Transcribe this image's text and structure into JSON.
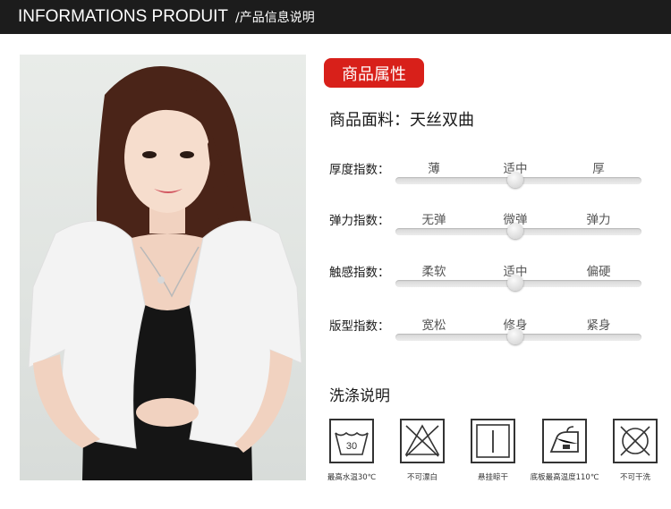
{
  "header": {
    "title_en": "INFORMATIONS PRODUIT",
    "title_cn": "/产品信息说明"
  },
  "product_photo": {
    "description_icon": "model-photo"
  },
  "attributes": {
    "badge": "商品属性",
    "fabric": "商品面料：天丝双曲"
  },
  "metrics": [
    {
      "label": "厚度指数：",
      "options": [
        "薄",
        "适中",
        "厚"
      ],
      "selected_index": 1
    },
    {
      "label": "弹力指数：",
      "options": [
        "无弹",
        "微弹",
        "弹力"
      ],
      "selected_index": 1
    },
    {
      "label": "触感指数：",
      "options": [
        "柔软",
        "适中",
        "偏硬"
      ],
      "selected_index": 1
    },
    {
      "label": "版型指数：",
      "options": [
        "宽松",
        "修身",
        "紧身"
      ],
      "selected_index": 1
    }
  ],
  "washing": {
    "title": "洗涤说明",
    "items": [
      {
        "icon": "wash-30-icon",
        "temp": "30",
        "caption": "最高水温30℃"
      },
      {
        "icon": "no-bleach-icon",
        "caption": "不可漂白"
      },
      {
        "icon": "hang-dry-icon",
        "caption": "悬挂晾干"
      },
      {
        "icon": "iron-icon",
        "caption": "底板最高温度110℃"
      },
      {
        "icon": "no-tumble-dry-icon",
        "caption": "不可干洗"
      }
    ]
  },
  "colors": {
    "header_bg": "#1c1c1c",
    "accent": "#d8201a"
  }
}
